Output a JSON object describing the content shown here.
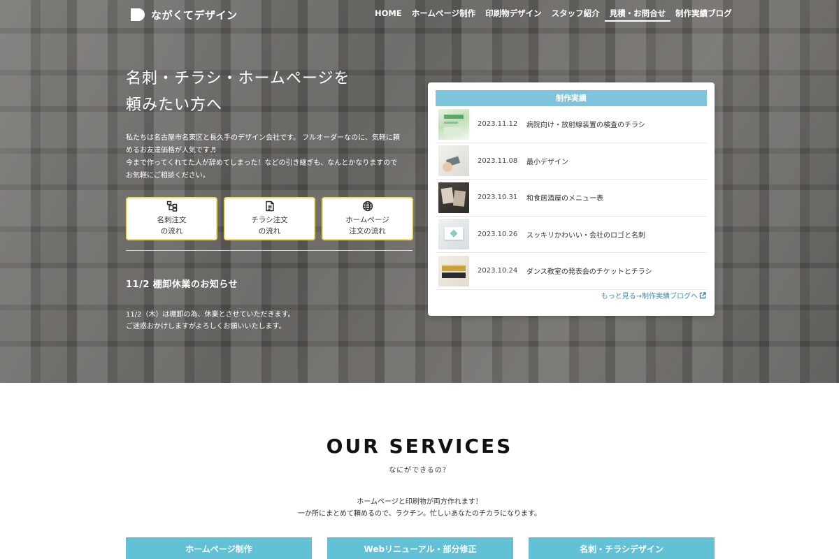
{
  "brand": {
    "name": "ながくてデザイン"
  },
  "nav": [
    {
      "label": "HOME"
    },
    {
      "label": "ホームページ制作"
    },
    {
      "label": "印刷物デザイン"
    },
    {
      "label": "スタッフ紹介"
    },
    {
      "label": "見積・お問合せ"
    },
    {
      "label": "制作実績ブログ"
    }
  ],
  "hero": {
    "title_line1": "名刺・チラシ・ホームページを",
    "title_line2": "頼みたい方へ",
    "desc_line1": "私たちは名古屋市名東区と長久手のデザイン会社です。 フルオーダーなのに、気軽に頼",
    "desc_line2": "めるお友達価格が人気です♬",
    "desc_line3": "今まで作ってくれてた人が辞めてしまった！などの引き継ぎも、なんとかなりますので",
    "desc_line4": "お気軽にご相談ください。"
  },
  "order_buttons": [
    {
      "line1": "名刺注文",
      "line2": "の流れ",
      "icon": "sitemap-icon"
    },
    {
      "line1": "チラシ注文",
      "line2": "の流れ",
      "icon": "document-icon"
    },
    {
      "line1": "ホームページ",
      "line2": "注文の流れ",
      "icon": "globe-icon"
    }
  ],
  "news": {
    "title": "11/2 棚卸休業のお知らせ",
    "line1": "11/2（木）は棚卸の為、休業とさせていただきます。",
    "line2": "ご迷惑おかけしますがよろしくお願いいたします。"
  },
  "works": {
    "header": "制作実績",
    "items": [
      {
        "date": "2023.11.12",
        "title": "病院向け・放射線装置の検査のチラシ"
      },
      {
        "date": "2023.11.08",
        "title": "最小デザイン"
      },
      {
        "date": "2023.10.31",
        "title": "和食居酒屋のメニュー表"
      },
      {
        "date": "2023.10.26",
        "title": "スッキリかわいい・会社のロゴと名刺"
      },
      {
        "date": "2023.10.24",
        "title": "ダンス教室の発表会のチケットとチラシ"
      }
    ],
    "more": "もっと見る→制作実績ブログへ"
  },
  "services": {
    "title": "OUR SERVICES",
    "subtitle": "なにができるの？",
    "desc_line1": "ホームページと印刷物が両方作れます！",
    "desc_line2": "一か所にまとめて頼めるので、ラクチン。忙しいあなたのチカラになります。",
    "tabs": [
      {
        "label": "ホームページ制作"
      },
      {
        "label": "Webリニューアル・部分修正"
      },
      {
        "label": "名刺・チラシデザイン"
      }
    ]
  },
  "colors": {
    "accent": "#7ec4dc",
    "service_tab": "#63c1d6",
    "button_border": "#f1dc60",
    "link": "#3a86b0"
  }
}
